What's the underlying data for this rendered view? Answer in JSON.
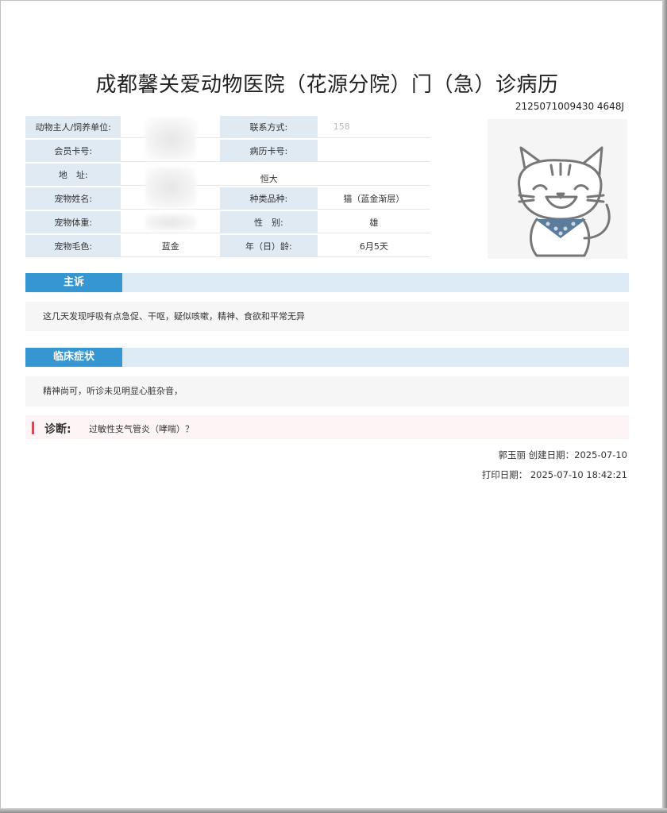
{
  "document": {
    "title": "成都馨关爱动物医院（花源分院）门（急）诊病历",
    "record_id": "2125071009430 4648J"
  },
  "info": {
    "rows": [
      {
        "l1": "动物主人/饲养单位:",
        "v1": "",
        "l2": "联系方式:",
        "v2": "158"
      },
      {
        "l1": "会员卡号:",
        "v1": "",
        "l2": "病历卡号:",
        "v2": ""
      },
      {
        "l1": "地　址:",
        "v1": "",
        "l2": "",
        "v2": "恒大"
      },
      {
        "l1": "宠物姓名:",
        "v1": "",
        "l2": "种类品种:",
        "v2": "猫（蓝金渐层）"
      },
      {
        "l1": "宠物体重:",
        "v1": "",
        "l2": "性　别:",
        "v2": "雄"
      },
      {
        "l1": "宠物毛色:",
        "v1": "蓝金",
        "l2": "年（日）龄:",
        "v2": "6月5天"
      }
    ]
  },
  "complaint": {
    "label": "主诉",
    "text": "这几天发现呼吸有点急促、干呕，疑似咳嗽，精神、食欲和平常无异"
  },
  "symptoms": {
    "label": "临床症状",
    "text": "精神尚可，听诊未见明显心脏杂音，"
  },
  "diagnosis": {
    "label": "诊断:",
    "text": "过敏性支气管炎（哮喘）？"
  },
  "footer": {
    "created": "郭玉丽 创建日期：2025-07-10",
    "printed": "打印日期：  2025-07-10 18:42:21"
  },
  "icons": {
    "mascot": "smiling-cat-illustration"
  }
}
